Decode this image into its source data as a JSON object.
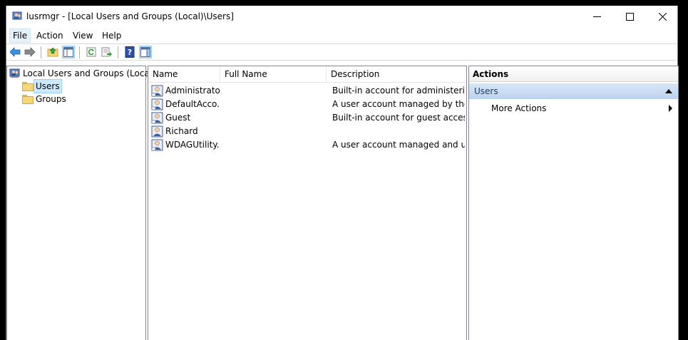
{
  "window": {
    "title": "lusrmgr - [Local Users and Groups (Local)\\Users]"
  },
  "menu": [
    {
      "label": "File",
      "active": true
    },
    {
      "label": "Action",
      "active": false
    },
    {
      "label": "View",
      "active": false
    },
    {
      "label": "Help",
      "active": false
    }
  ],
  "toolbar": {
    "icons": [
      "back-arrow-icon",
      "forward-arrow-icon",
      "up-folder-icon",
      "show-hide-console-tree-icon",
      "refresh-icon",
      "export-list-icon",
      "help-icon",
      "show-hide-action-pane-icon"
    ]
  },
  "tree": {
    "root": "Local Users and Groups (Local)",
    "children": [
      {
        "label": "Users",
        "selected": true
      },
      {
        "label": "Groups",
        "selected": false
      }
    ]
  },
  "list": {
    "columns": [
      "Name",
      "Full Name",
      "Description"
    ],
    "rows": [
      {
        "name": "Administrator",
        "full_name": "",
        "description": "Built-in account for administering..."
      },
      {
        "name": "DefaultAcco...",
        "full_name": "",
        "description": "A user account managed by the s..."
      },
      {
        "name": "Guest",
        "full_name": "",
        "description": "Built-in account for guest access t..."
      },
      {
        "name": "Richard",
        "full_name": "",
        "description": ""
      },
      {
        "name": "WDAGUtility...",
        "full_name": "",
        "description": "A user account managed and use..."
      }
    ]
  },
  "actions": {
    "header": "Actions",
    "section": "Users",
    "items": [
      "More Actions"
    ]
  },
  "colors": {
    "selection_bg": "#cce8ff",
    "actions_section_bg": "#bcd3ee",
    "toolbar_pressed": "#cce4f7"
  }
}
